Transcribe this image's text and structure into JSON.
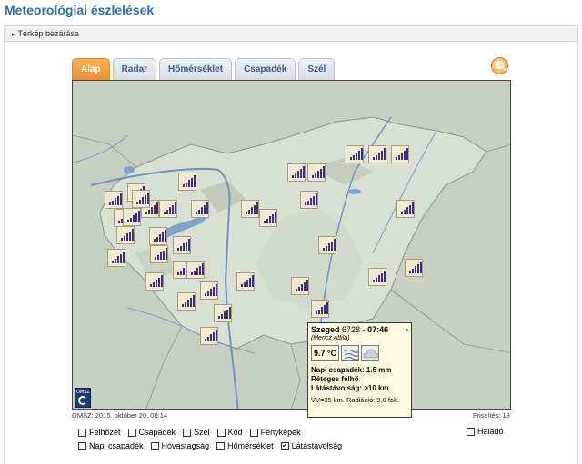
{
  "page": {
    "title": "Meteorológiai észlelések"
  },
  "collapse": {
    "label": "Térkép bezárása"
  },
  "tabs": [
    {
      "label": "Alap",
      "active": true
    },
    {
      "label": "Radar",
      "active": false
    },
    {
      "label": "Hőmérséklet",
      "active": false
    },
    {
      "label": "Csapadék",
      "active": false
    },
    {
      "label": "Szél",
      "active": false
    }
  ],
  "icons": {
    "search": "search-icon",
    "logo": "omsz-logo-icon",
    "weather": "fog-wind-icon",
    "cloud": "cloud-icon"
  },
  "colors": {
    "accent": "#ee8f2a",
    "title": "#2a6fb0",
    "station_bars": "#3c2f86",
    "popup_bg": "#fffbe0"
  },
  "map": {
    "logo_text": "OMSZ",
    "stations_count": 36
  },
  "popup": {
    "station_name": "Szeged",
    "station_id": "6728",
    "time": "07:46",
    "observer": "(Mericz Attila)",
    "temperature": "9.7 °C",
    "precip": "Napi csapadék: 1.5 mm",
    "cloud": "Réteges felhő",
    "visibility": "Látástávolság: >10 km",
    "extra": "VV=35 km. Radiáció: 9.0 fok."
  },
  "footer": {
    "timestamp": "OMSZ: 2015. október 20. 08:14",
    "refresh": "Frissítés: 18"
  },
  "layers": {
    "row1": [
      {
        "label": "Felhőzet",
        "checked": false
      },
      {
        "label": "Csapadék",
        "checked": false
      },
      {
        "label": "Szél",
        "checked": false
      },
      {
        "label": "Köd",
        "checked": false
      },
      {
        "label": "Fényképek",
        "checked": false
      }
    ],
    "row2": [
      {
        "label": "Napi csapadék",
        "checked": false
      },
      {
        "label": "Hóvastagság",
        "checked": false
      },
      {
        "label": "Hőmérséklet",
        "checked": false
      },
      {
        "label": "Látástávolság",
        "checked": true
      }
    ],
    "advanced": {
      "label": "Haladó",
      "checked": false
    }
  }
}
